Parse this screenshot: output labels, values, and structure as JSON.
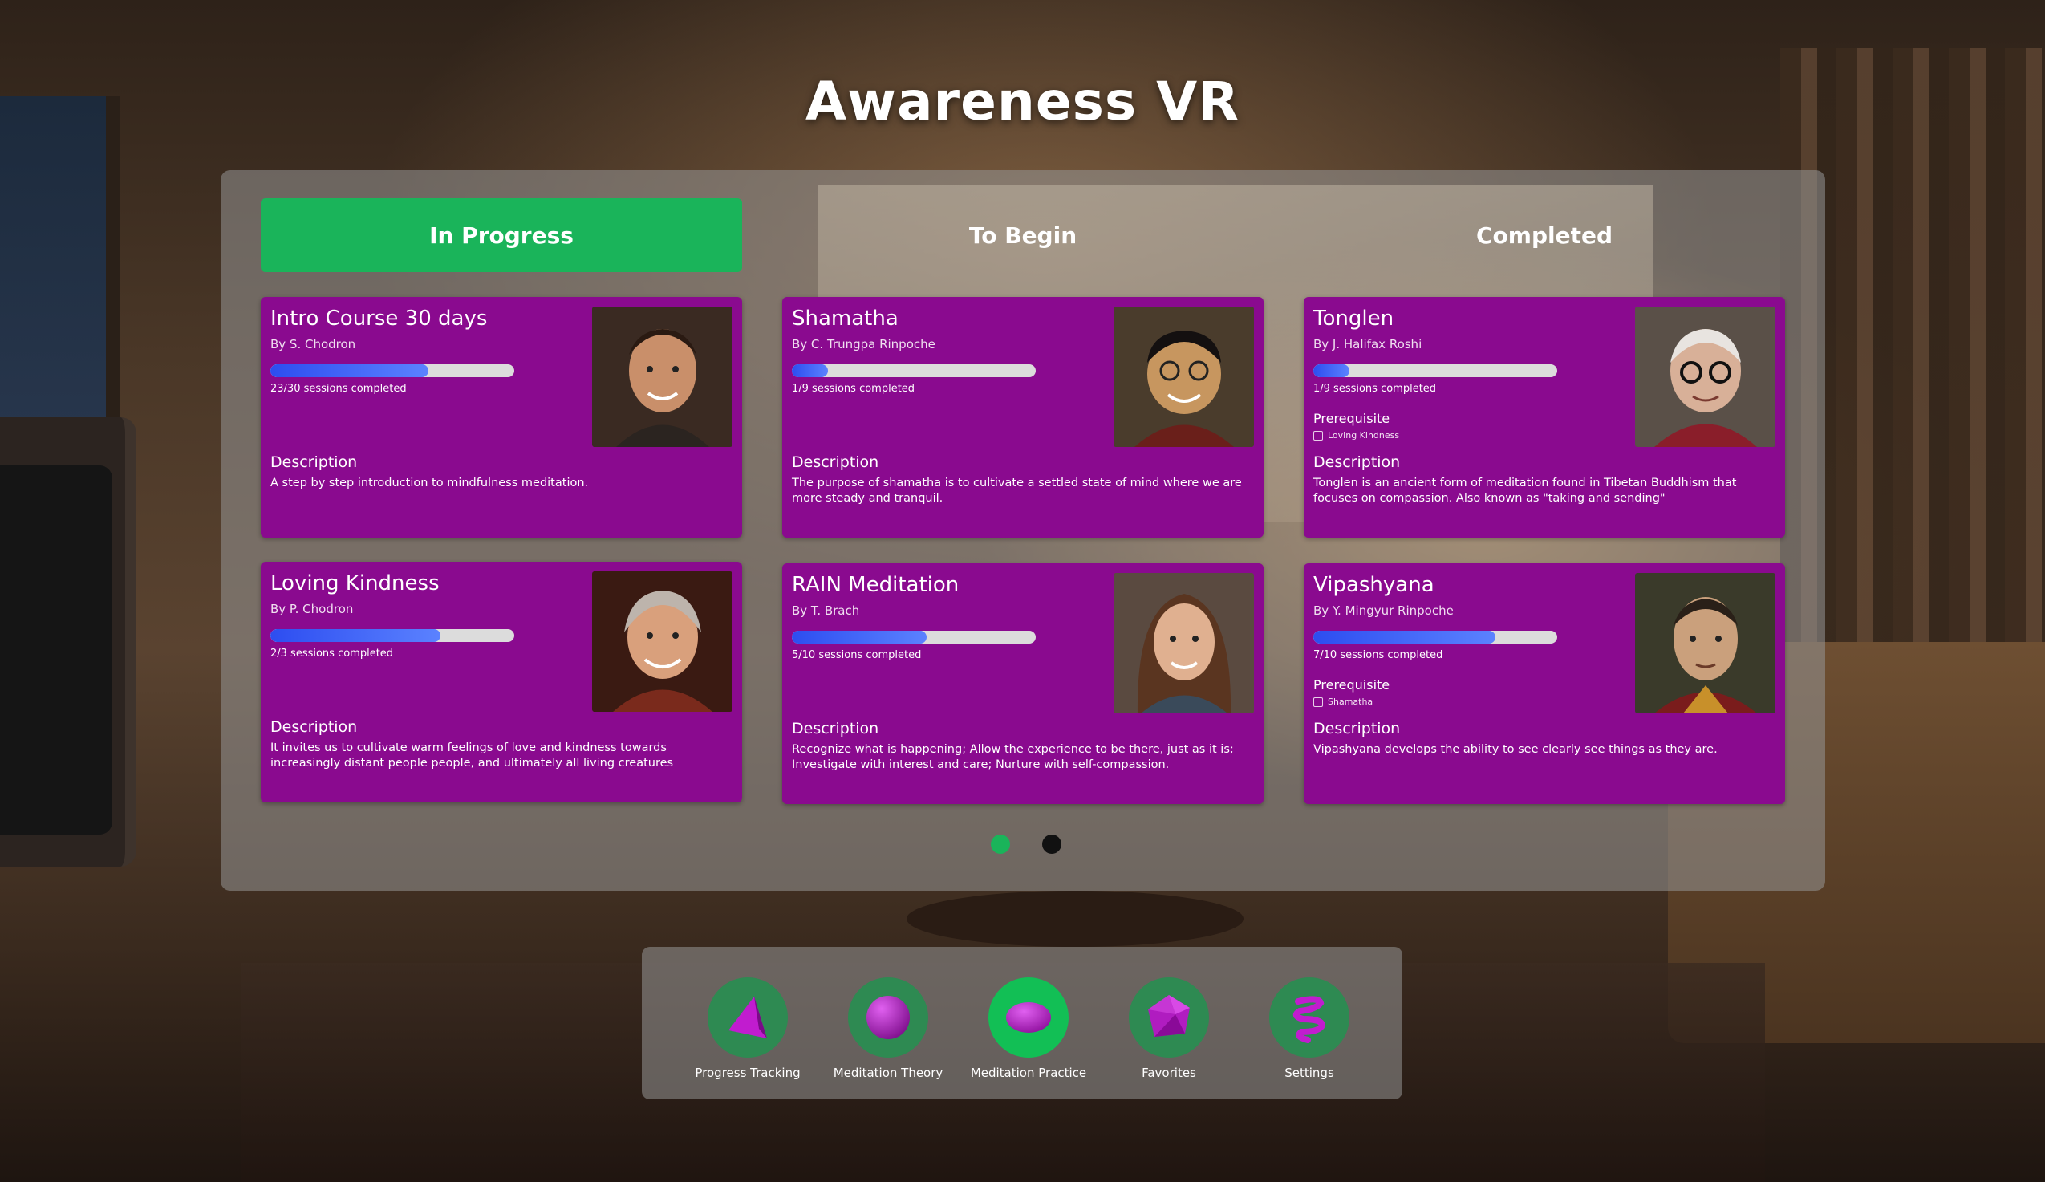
{
  "app": {
    "title": "Awareness VR"
  },
  "tabs": [
    {
      "label": "In Progress",
      "active": true
    },
    {
      "label": "To Begin",
      "active": false
    },
    {
      "label": "Completed",
      "active": false
    }
  ],
  "courses": [
    {
      "title": "Intro Course 30 days",
      "author": "By S. Chodron",
      "progress": 0.6467,
      "progress_text": "23/30 sessions completed",
      "description_label": "Description",
      "description": "A step by step introduction to mindfulness meditation."
    },
    {
      "title": "Shamatha",
      "author": "By C. Trungpa Rinpoche",
      "progress": 0.1467,
      "progress_text": "1/9 sessions completed",
      "description_label": "Description",
      "description": "The purpose of shamatha is to cultivate a settled state of mind where we are more steady and tranquil."
    },
    {
      "title": "Tonglen",
      "author": "By J. Halifax Roshi",
      "progress": 0.1467,
      "progress_text": "1/9 sessions completed",
      "prerequisite_label": "Prerequisite",
      "prerequisite": "Loving Kindness",
      "description_label": "Description",
      "description": "Tonglen is an ancient form of meditation found in Tibetan Buddhism that focuses on compassion. Also known as \"taking and sending\""
    },
    {
      "title": "Loving Kindness",
      "author": "By P. Chodron",
      "progress": 0.6967,
      "progress_text": "2/3 sessions completed",
      "description_label": "Description",
      "description": "It invites us to cultivate warm feelings of love and kindness towards increasingly distant people people, and ultimately all living creatures"
    },
    {
      "title": "RAIN Meditation",
      "author": "By T. Brach",
      "progress": 0.5533,
      "progress_text": "5/10 sessions completed",
      "description_label": "Description",
      "description": "Recognize what is happening; Allow the experience to be there, just as it is; Investigate with interest and care; Nurture with self-compassion."
    },
    {
      "title": "Vipashyana",
      "author": "By Y. Mingyur Rinpoche",
      "progress": 0.7467,
      "progress_text": "7/10 sessions completed",
      "prerequisite_label": "Prerequisite",
      "prerequisite": "Shamatha",
      "description_label": "Description",
      "description": "Vipashyana develops the ability to see clearly see things as they are."
    }
  ],
  "pagination": {
    "pages": 2,
    "current": 1,
    "active_color": "#1ab45a",
    "inactive_color": "#111111"
  },
  "dock": [
    {
      "label": "Progress Tracking",
      "icon": "pyramid-icon",
      "active": false
    },
    {
      "label": "Meditation Theory",
      "icon": "sphere-icon",
      "active": false
    },
    {
      "label": "Meditation Practice",
      "icon": "ellipse-icon",
      "active": true
    },
    {
      "label": "Favorites",
      "icon": "polyhedron-icon",
      "active": false
    },
    {
      "label": "Settings",
      "icon": "spiral-icon",
      "active": false
    }
  ],
  "colors": {
    "card": "#8a0a8f",
    "accent_green": "#1ab45a",
    "progress_blue": "#2d4df0",
    "icon_magenta": "#b01cc0"
  }
}
